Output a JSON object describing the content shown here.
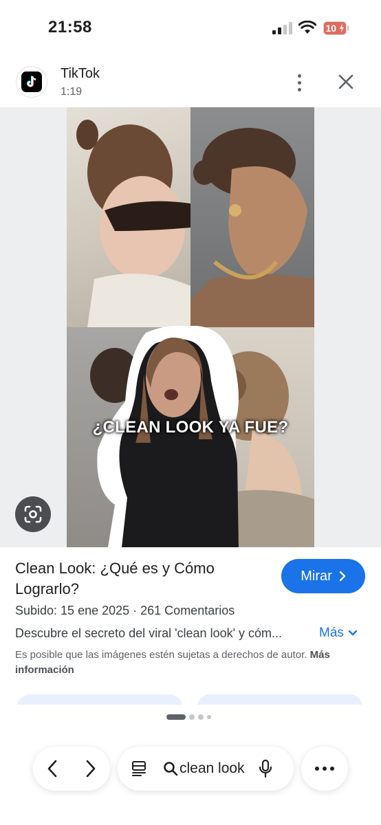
{
  "status_bar": {
    "time": "21:58",
    "battery": "10"
  },
  "header": {
    "app_name": "TikTok",
    "duration": "1:19"
  },
  "preview": {
    "caption": "¿CLEAN LOOK YA FUE?"
  },
  "result": {
    "title": "Clean Look: ¿Qué es y Cómo Lograrlo?",
    "cta": "Mirar",
    "meta": "Subido: 15 ene 2025 · 261 Comentarios",
    "description": "Descubre el secreto del viral 'clean look' y cóm...",
    "more": "Más",
    "copyright_text": "Es posible que las imágenes estén sujetas a derechos de autor.",
    "copyright_link": "Más información"
  },
  "bottom_bar": {
    "query": "clean look"
  },
  "colors": {
    "accent": "#1a73e8",
    "background": "#f1f3f4"
  }
}
